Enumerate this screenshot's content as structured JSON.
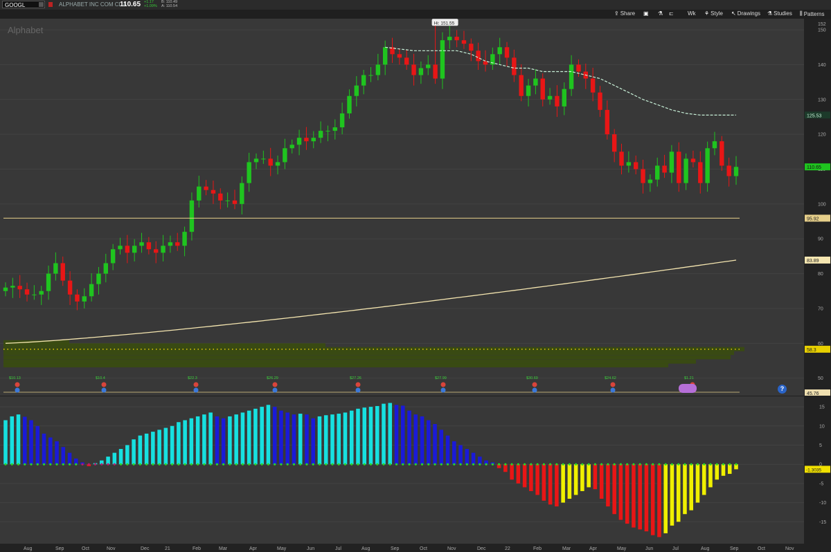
{
  "header": {
    "symbol": "GOOGL",
    "company": "ALPHABET INC COM CL A",
    "last": "110.65",
    "change": "+1.17",
    "change_pct": "+1.09%",
    "bid": "B: 110.49",
    "ask": "A: 110.54"
  },
  "toolbar": {
    "share": "Share",
    "aggregation": "Wk",
    "style": "Style",
    "drawings": "Drawings",
    "studies": "Studies",
    "patterns": "Patterns"
  },
  "chart": {
    "label": "Alphabet",
    "hi_label": "Hi: 151.55",
    "price_ticks": [
      "150",
      "140",
      "130",
      "120",
      "110",
      "100",
      "90",
      "80",
      "70",
      "60",
      "50"
    ],
    "axis_labels": {
      "top": "152",
      "ma_short": "125.53",
      "last": "110.65",
      "line_h": "95.92",
      "ma_long": "83.89",
      "dotted": "58.3",
      "bottom": "45.76"
    },
    "colors": {
      "up": "#1fc41f",
      "down": "#e81616",
      "ma_short": "#c8f0d8",
      "ma_long": "#f5e6b0",
      "hline": "#e6cf8a",
      "volume_profile": "#3a4d10"
    }
  },
  "chart_data": {
    "type": "candlestick",
    "interval": "weekly",
    "ylim": [
      45,
      153
    ],
    "high": 151.55,
    "horizontal_line": 95.92,
    "dotted_line": 58.3,
    "ma_short_last": 125.53,
    "ma_long_last": 83.89,
    "last_close": 110.65,
    "months": [
      "Aug",
      "Sep",
      "Oct",
      "Nov",
      "Dec",
      "21",
      "Feb",
      "Mar",
      "Apr",
      "May",
      "Jun",
      "Jul",
      "Aug",
      "Sep",
      "Oct",
      "Nov",
      "Dec",
      "22",
      "Feb",
      "Mar",
      "Apr",
      "May",
      "Jun",
      "Jul",
      "Aug",
      "Sep",
      "Oct",
      "Nov"
    ],
    "earnings_labels": [
      "$10.13",
      "$10.4",
      "$22.3",
      "$26.29",
      "$27.26",
      "$27.99",
      "$30.69",
      "$24.62",
      "$1.21"
    ],
    "closes": [
      76,
      76.5,
      75.5,
      74,
      74,
      75,
      80,
      83,
      78,
      74,
      72,
      73.5,
      77,
      80,
      83,
      87,
      88,
      86,
      88,
      89,
      87,
      86,
      88,
      89,
      88,
      92,
      101,
      105,
      104,
      103,
      101,
      101,
      100,
      106,
      112,
      113,
      113,
      111,
      112,
      116,
      117,
      119,
      118,
      119,
      121,
      121,
      122,
      126,
      131,
      134,
      137,
      137,
      140,
      145,
      143,
      142,
      140,
      137,
      139,
      140,
      136,
      147,
      148,
      147,
      146,
      144,
      141,
      140,
      143,
      145,
      142,
      137,
      131,
      134,
      136,
      130,
      131,
      128,
      133,
      140,
      138,
      136,
      132,
      127,
      120,
      115,
      111,
      112,
      110,
      106,
      107,
      111,
      109,
      115,
      106,
      113,
      112,
      106,
      116,
      118,
      111,
      108,
      110.65
    ],
    "indicator": {
      "ylim": [
        -20,
        17
      ],
      "ticks": [
        "15",
        "10",
        "5",
        "0",
        "-5",
        "-10",
        "-15"
      ],
      "last": "-1.3035",
      "values": [
        11.5,
        12.5,
        13,
        12.4,
        11.5,
        10,
        8,
        7,
        6,
        4.5,
        3,
        1.5,
        0.5,
        -0.5,
        0.3,
        1,
        2,
        3,
        4,
        5,
        6.5,
        7.5,
        8,
        8.5,
        9,
        9.5,
        10,
        11,
        11.5,
        12,
        12.5,
        13,
        13.5,
        12.5,
        12,
        12.5,
        13,
        13.5,
        14,
        14.5,
        15,
        15.5,
        15,
        14,
        13.5,
        13,
        13.2,
        13,
        12,
        12.5,
        12.8,
        13,
        13.2,
        13.5,
        14,
        14.5,
        14.8,
        15,
        15.2,
        15.8,
        16,
        15.5,
        15.3,
        14,
        13,
        12.5,
        11.5,
        10.5,
        9,
        7.5,
        6,
        5,
        4,
        3,
        2,
        1,
        0.5,
        -1,
        -2,
        -4,
        -5,
        -6,
        -7,
        -8,
        -9.5,
        -10.5,
        -11,
        -10,
        -9,
        -8,
        -7,
        -6,
        -6.5,
        -9,
        -11,
        -13,
        -14.5,
        -15.5,
        -16.5,
        -17,
        -17.5,
        -18.5,
        -19,
        -18,
        -16,
        -15,
        -13,
        -12,
        -10,
        -8,
        -6,
        -4,
        -3,
        -2.5,
        -1.3
      ]
    }
  },
  "indicator_pane": {
    "label_last": "-1.3035"
  }
}
